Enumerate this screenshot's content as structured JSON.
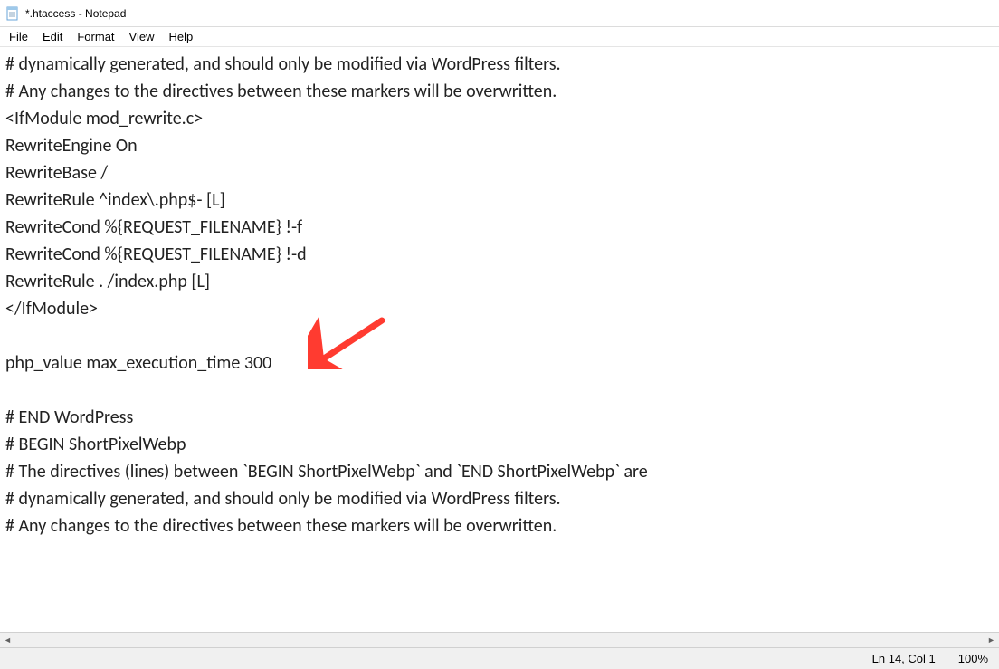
{
  "titlebar": {
    "title": "*.htaccess - Notepad"
  },
  "menubar": {
    "items": [
      "File",
      "Edit",
      "Format",
      "View",
      "Help"
    ]
  },
  "editor": {
    "content": "# dynamically generated, and should only be modified via WordPress filters.\n# Any changes to the directives between these markers will be overwritten.\n<IfModule mod_rewrite.c>\nRewriteEngine On\nRewriteBase /\nRewriteRule ^index\\.php$- [L]\nRewriteCond %{REQUEST_FILENAME} !-f\nRewriteCond %{REQUEST_FILENAME} !-d\nRewriteRule . /index.php [L]\n</IfModule>\n\nphp_value max_execution_time 300\n\n# END WordPress\n# BEGIN ShortPixelWebp\n# The directives (lines) between `BEGIN ShortPixelWebp` and `END ShortPixelWebp` are\n# dynamically generated, and should only be modified via WordPress filters.\n# Any changes to the directives between these markers will be overwritten."
  },
  "statusbar": {
    "position": "Ln 14, Col 1",
    "zoom": "100%"
  },
  "annotation": {
    "arrow_color": "#ff3b30"
  }
}
